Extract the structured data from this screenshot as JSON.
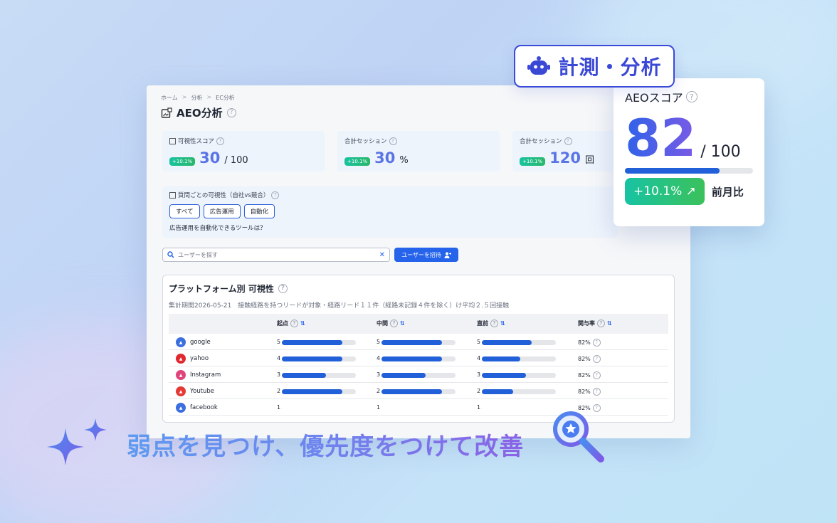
{
  "breadcrumb": [
    "ホーム",
    "分析",
    "EC分析"
  ],
  "page_title": "AEO分析",
  "kpis": [
    {
      "label": "可視性スコア",
      "delta": "+10.1%",
      "value": "30",
      "unit": "/ 100"
    },
    {
      "label": "合計セッション",
      "delta": "+10.1%",
      "value": "30",
      "unit": "%"
    },
    {
      "label": "合計セッション",
      "delta": "+10.1%",
      "value": "120",
      "unit": "回"
    }
  ],
  "question_box": {
    "label": "質問ごとの可視性（自社vs競合）",
    "chips": [
      "すべて",
      "広告運用",
      "自動化"
    ],
    "question": "広告運用を自動化できるツールは？"
  },
  "search": {
    "placeholder": "ユーザーを探す"
  },
  "invite_button": "ユーザーを招待",
  "platform_card": {
    "title": "プラットフォーム別 可視性",
    "subtitle": "集計期間2026-05-21　接触経路を持つリードが対象・経路リード１１件（経路未記録４件を除く）け平均２.５回接触",
    "columns": [
      "起点",
      "中間",
      "直前",
      "関与率"
    ],
    "rows": [
      {
        "name": "google",
        "logo_color": "#3b6fe0",
        "start": 5,
        "middle": 5,
        "last": 5,
        "start_level": 0.82,
        "middle_level": 0.82,
        "last_level": 0.67,
        "rate": "82%"
      },
      {
        "name": "yahoo",
        "logo_color": "#e0282e",
        "start": 4,
        "middle": 4,
        "last": 4,
        "start_level": 0.82,
        "middle_level": 0.82,
        "last_level": 0.52,
        "rate": "82%"
      },
      {
        "name": "Instagram",
        "logo_color": "#e0447a",
        "start": 3,
        "middle": 3,
        "last": 3,
        "start_level": 0.6,
        "middle_level": 0.6,
        "last_level": 0.6,
        "rate": "82%"
      },
      {
        "name": "Youtube",
        "logo_color": "#e53935",
        "start": 2,
        "middle": 2,
        "last": 2,
        "start_level": 0.82,
        "middle_level": 0.82,
        "last_level": 0.42,
        "rate": "82%"
      },
      {
        "name": "facebook",
        "logo_color": "#3b6fe0",
        "start": 1,
        "middle": 1,
        "last": 1,
        "start_level": 0,
        "middle_level": 0,
        "last_level": 0,
        "rate": "82%"
      }
    ]
  },
  "score_card": {
    "label": "AEOスコア",
    "value": "82",
    "denominator": "/ 100",
    "level": 0.74,
    "delta": "+10.1% ↗",
    "comparison": "前月比"
  },
  "tag": {
    "text": "計測・分析"
  },
  "tagline": "弱点を見つけ、優先度をつけて改善",
  "colors": {
    "accent": "#2563eb",
    "delta_green": "#18c3a0",
    "tag_border": "#3a4ad9"
  }
}
